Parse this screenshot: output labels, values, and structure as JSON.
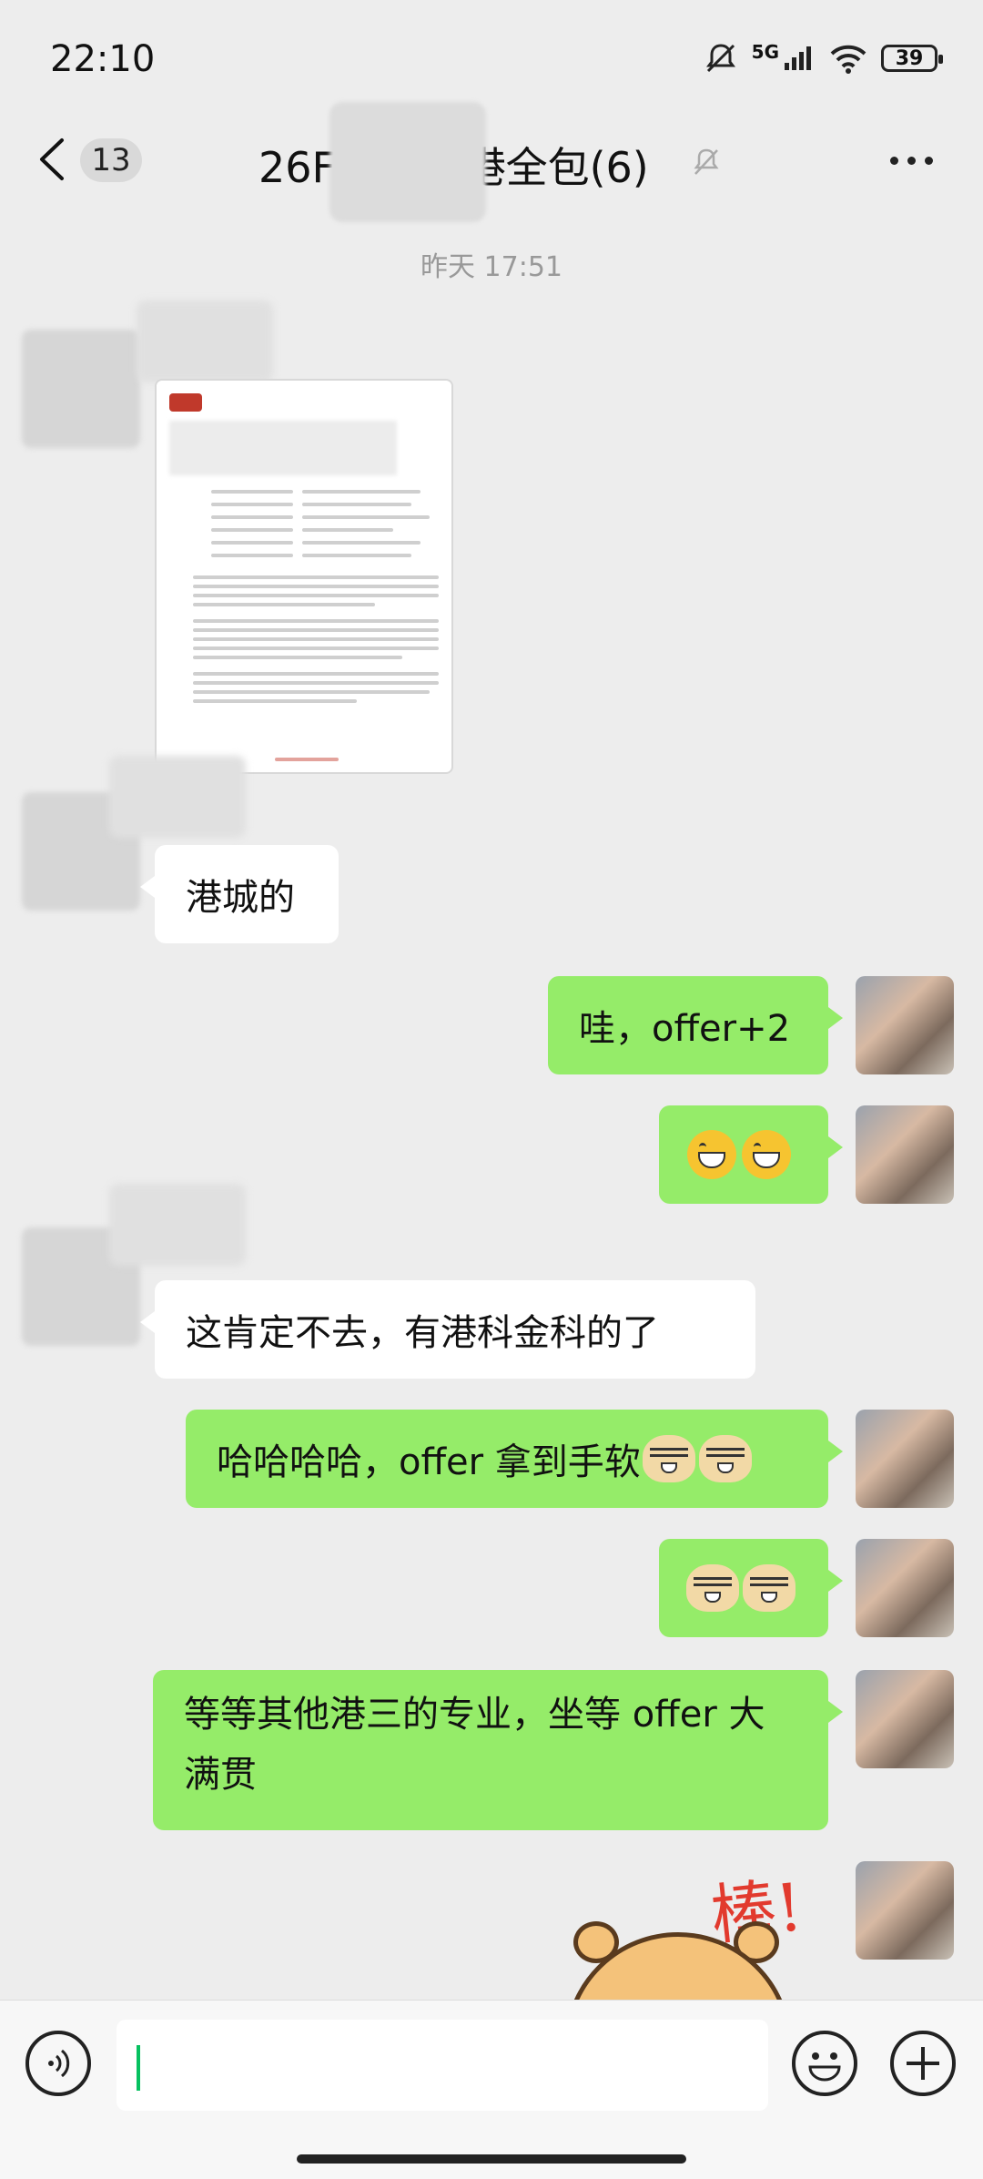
{
  "status_bar": {
    "time": "22:10",
    "network": "5G",
    "battery": "39"
  },
  "header": {
    "unread_count": "13",
    "title_prefix": "26F",
    "title_suffix": "-港全包(6)"
  },
  "chat": {
    "timestamp": "昨天 17:51",
    "messages": [
      {
        "side": "left",
        "type": "file",
        "text": ""
      },
      {
        "side": "left",
        "type": "text",
        "text": "港城的"
      },
      {
        "side": "right",
        "type": "text",
        "text": "哇，offer+2"
      },
      {
        "side": "right",
        "type": "emoji",
        "emoji": "grin-emoji"
      },
      {
        "side": "left",
        "type": "text",
        "text": "这肯定不去，有港科金科的了"
      },
      {
        "side": "right",
        "type": "text",
        "text": "哈哈哈哈，offer 拿到手软"
      },
      {
        "side": "right",
        "type": "emoji",
        "emoji": "doge-emoji"
      },
      {
        "side": "right",
        "type": "text",
        "text": "等等其他港三的专业，坐等 offer 大满贯"
      },
      {
        "side": "right",
        "type": "sticker",
        "text": "棒!"
      }
    ]
  },
  "colors": {
    "my_bubble": "#95ec69",
    "their_bubble": "#ffffff",
    "background": "#ededed",
    "cursor": "#07c160"
  }
}
